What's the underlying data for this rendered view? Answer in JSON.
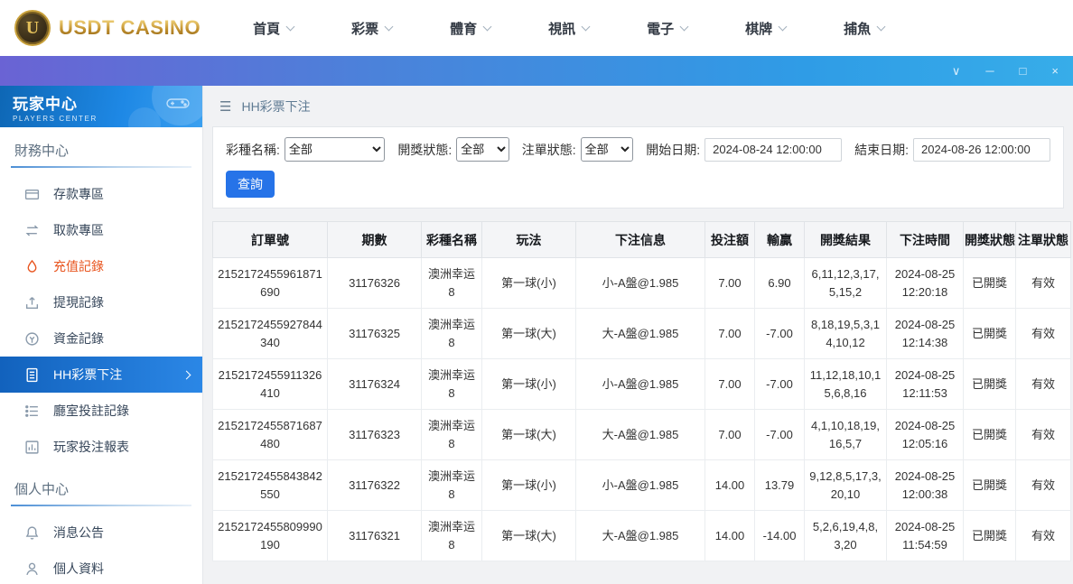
{
  "colors": {
    "accent_blue": "#1e88e5",
    "highlight_orange": "#e8541e",
    "titlebar_gradient_start": "#6a63d4",
    "titlebar_gradient_end": "#37ade9",
    "gold": "#c9a13b"
  },
  "topnav": {
    "logo": {
      "text": "USDT CASINO",
      "badge_letter": "U"
    },
    "items": [
      {
        "label": "首頁"
      },
      {
        "label": "彩票"
      },
      {
        "label": "體育"
      },
      {
        "label": "視訊"
      },
      {
        "label": "電子"
      },
      {
        "label": "棋牌"
      },
      {
        "label": "捕魚"
      }
    ]
  },
  "titlebar": {
    "dropdown": "∨",
    "minimize": "─",
    "maximize": "□",
    "close": "×"
  },
  "sidebar": {
    "title": "玩家中心",
    "subtitle": "PLAYERS CENTER",
    "sections": [
      {
        "title": "財務中心",
        "items": [
          {
            "label": "存款專區"
          },
          {
            "label": "取款專區"
          },
          {
            "label": "充值記錄"
          },
          {
            "label": "提現記錄"
          },
          {
            "label": "資金記錄"
          },
          {
            "label": "HH彩票下注"
          },
          {
            "label": "廳室投註記錄"
          },
          {
            "label": "玩家投注報表"
          }
        ]
      },
      {
        "title": "個人中心",
        "items": [
          {
            "label": "消息公告"
          },
          {
            "label": "個人資料"
          }
        ]
      }
    ]
  },
  "breadcrumb": {
    "menu_icon": "☰",
    "label": "HH彩票下注"
  },
  "filters": {
    "lottery_label": "彩種名稱:",
    "lottery_value": "全部",
    "draw_status_label": "開獎狀態:",
    "draw_status_value": "全部",
    "bet_status_label": "注單狀態:",
    "bet_status_value": "全部",
    "start_date_label": "開始日期:",
    "start_date_value": "2024-08-24 12:00:00",
    "end_date_label": "結束日期:",
    "end_date_value": "2024-08-26 12:00:00",
    "search_label": "查詢"
  },
  "table": {
    "headers": [
      "訂單號",
      "期數",
      "彩種名稱",
      "玩法",
      "下注信息",
      "投注額",
      "輸贏",
      "開獎結果",
      "下注時間",
      "開獎狀態",
      "注單狀態"
    ],
    "rows": [
      [
        "2152172455961871690",
        "31176326",
        "澳洲幸运8",
        "第一球(小)",
        "小-A盤@1.985",
        "7.00",
        "6.90",
        "6,11,12,3,17,5,15,2",
        "2024-08-25 12:20:18",
        "已開獎",
        "有效"
      ],
      [
        "2152172455927844340",
        "31176325",
        "澳洲幸运8",
        "第一球(大)",
        "大-A盤@1.985",
        "7.00",
        "-7.00",
        "8,18,19,5,3,14,10,12",
        "2024-08-25 12:14:38",
        "已開獎",
        "有效"
      ],
      [
        "2152172455911326410",
        "31176324",
        "澳洲幸运8",
        "第一球(小)",
        "小-A盤@1.985",
        "7.00",
        "-7.00",
        "11,12,18,10,15,6,8,16",
        "2024-08-25 12:11:53",
        "已開獎",
        "有效"
      ],
      [
        "2152172455871687480",
        "31176323",
        "澳洲幸运8",
        "第一球(大)",
        "大-A盤@1.985",
        "7.00",
        "-7.00",
        "4,1,10,18,19,16,5,7",
        "2024-08-25 12:05:16",
        "已開獎",
        "有效"
      ],
      [
        "2152172455843842550",
        "31176322",
        "澳洲幸运8",
        "第一球(小)",
        "小-A盤@1.985",
        "14.00",
        "13.79",
        "9,12,8,5,17,3,20,10",
        "2024-08-25 12:00:38",
        "已開獎",
        "有效"
      ],
      [
        "2152172455809990190",
        "31176321",
        "澳洲幸运8",
        "第一球(大)",
        "大-A盤@1.985",
        "14.00",
        "-14.00",
        "5,2,6,19,4,8,3,20",
        "2024-08-25 11:54:59",
        "已開獎",
        "有效"
      ]
    ]
  }
}
